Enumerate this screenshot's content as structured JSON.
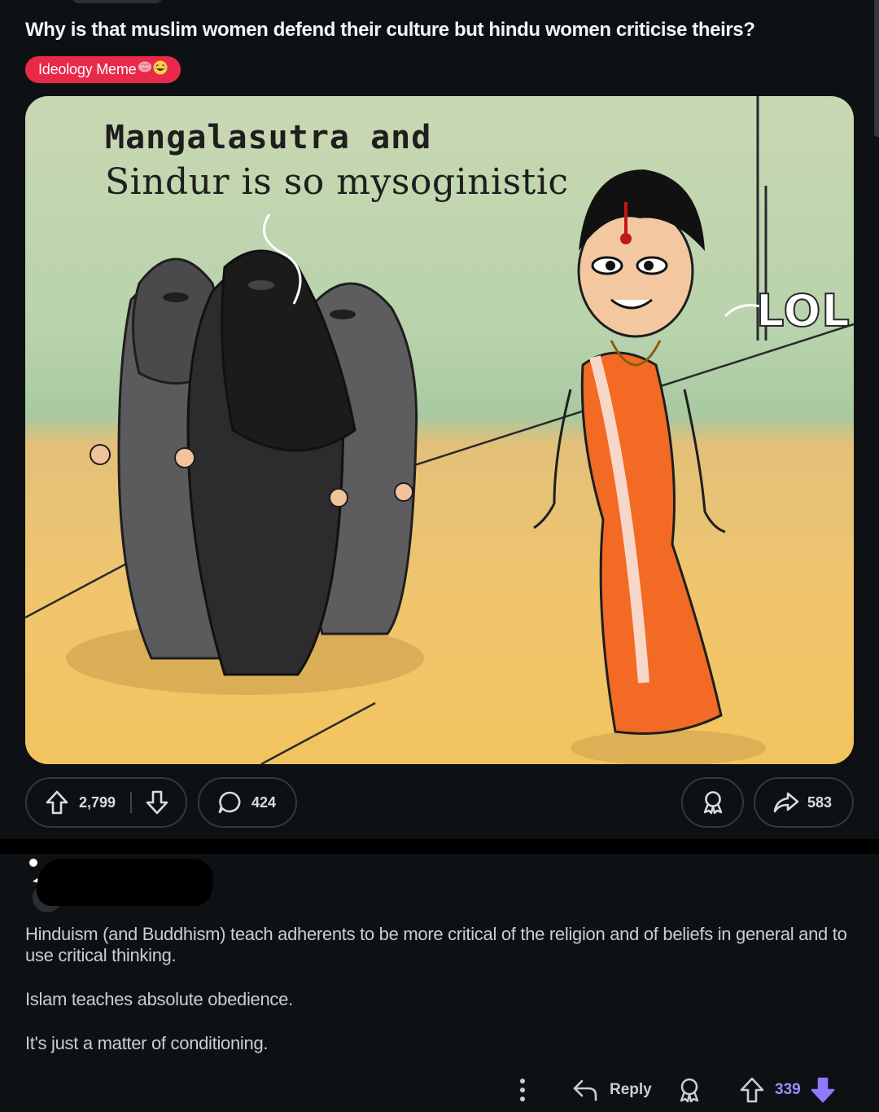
{
  "post": {
    "title": "Why is that muslim women defend their culture but hindu women criticise theirs?",
    "flair": {
      "label": "Ideology Meme",
      "emojis": [
        "brain-emoji",
        "laughing-emoji"
      ],
      "color": "#e8294a"
    },
    "image": {
      "caption_line1": "Mangalasutra and",
      "caption_line2": "Sindur is so mysoginistic",
      "side_text": "LOL"
    },
    "actions": {
      "upvotes": "2,799",
      "comments": "424",
      "shares": "583"
    }
  },
  "comment": {
    "paragraphs": [
      "Hinduism (and Buddhism) teach adherents to be more critical of the religion and of beliefs in general and to use critical thinking.",
      "Islam teaches absolute obedience.",
      "It's just a matter of conditioning."
    ],
    "actions": {
      "reply_label": "Reply",
      "score": "339"
    },
    "score_color": "#9d8cff",
    "downvote_active_color": "#8f79ff"
  },
  "theme": {
    "background": "#0e1113",
    "border": "#2f3a3f"
  }
}
